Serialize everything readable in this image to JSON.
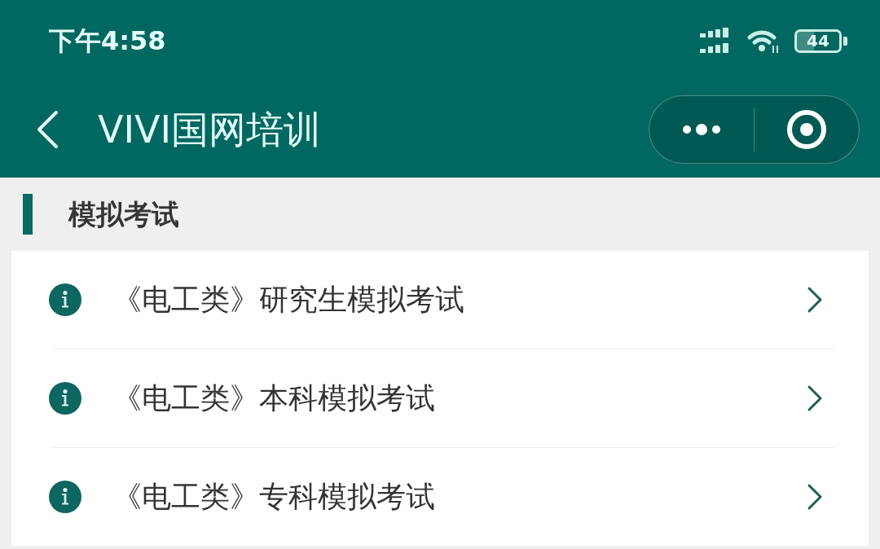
{
  "status_bar": {
    "time": "下午4:58",
    "battery": "44"
  },
  "nav_bar": {
    "title": "VIVI国网培训"
  },
  "section": {
    "title": "模拟考试"
  },
  "exam_list": [
    {
      "label": "《电工类》研究生模拟考试"
    },
    {
      "label": "《电工类》本科模拟考试"
    },
    {
      "label": "《电工类》专科模拟考试"
    }
  ]
}
